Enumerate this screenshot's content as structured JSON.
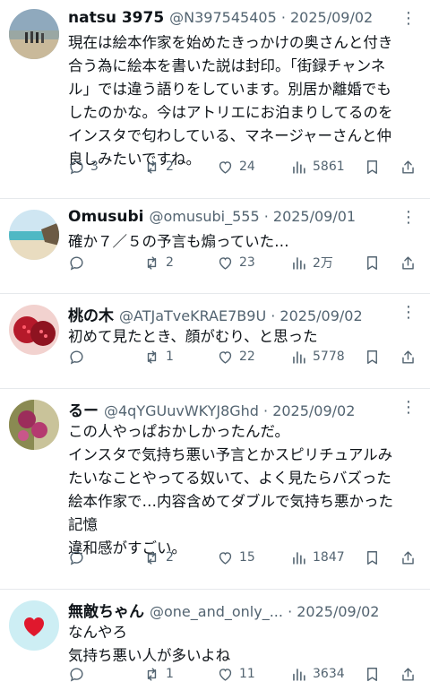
{
  "tweets": [
    {
      "name": "natsu 3975",
      "meta": "@N397545405 · 2025/09/02",
      "more": "⋮",
      "body": "現在は絵本作家を始めたきっかけの奥さんと付き\n合う為に絵本を書いた説は封印。「街録チャンネ\nル」では違う語りをしています。別居か離婚でも\nしたのかな。今はアトリエにお泊まりしてるのを\nインスタで匂わしている、マネージャーさんと仲\n良しみたいですね。",
      "replies": "3",
      "retweets": "2",
      "likes": "24",
      "views": "5861"
    },
    {
      "name": "Omusubi",
      "meta": "@omusubi_555 · 2025/09/01",
      "more": "⋮",
      "body": "確か７／５の予言も煽っていた…",
      "replies": "",
      "retweets": "2",
      "likes": "23",
      "views": "2万"
    },
    {
      "name": "桃の木",
      "meta": "@ATJaTveKRAE7B9U · 2025/09/02",
      "more": "⋮",
      "body": "初めて見たとき、顔がむり、と思った",
      "replies": "",
      "retweets": "1",
      "likes": "22",
      "views": "5778"
    },
    {
      "name": "るー",
      "meta": "@4qYGUuvWKYJ8Ghd · 2025/09/02",
      "more": "⋮",
      "body": "この人やっぱおかしかったんだ。\nインスタで気持ち悪い予言とかスピリチュアルみ\nたいなことやってる奴いて、よく見たらバズった\n絵本作家で…内容含めてダブルで気持ち悪かった\n記憶\n違和感がすごい。",
      "replies": "",
      "retweets": "2",
      "likes": "15",
      "views": "1847"
    },
    {
      "name": "無敵ちゃん",
      "meta": "@one_and_only_... · 2025/09/02",
      "more": "⋮",
      "body": "なんやろ\n気持ち悪い人が多いよね",
      "replies": "",
      "retweets": "1",
      "likes": "11",
      "views": "3634"
    }
  ]
}
